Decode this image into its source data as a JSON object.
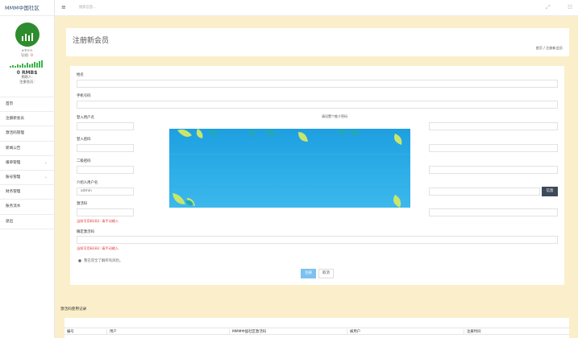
{
  "app": {
    "brand": "MMM中国社区"
  },
  "topbar": {
    "search_placeholder": "搜索信息..."
  },
  "profile": {
    "username": "admin",
    "level_prefix": "钻级:",
    "level_value": "0",
    "amount": "0 RMB$",
    "stat1": "捐助人:",
    "stat2": "注册会员:"
  },
  "nav": [
    {
      "label": "首页"
    },
    {
      "label": "注册新会员"
    },
    {
      "label": "激活码管理"
    },
    {
      "label": "新闻公告"
    },
    {
      "label": "报单管理"
    },
    {
      "label": "账号管理"
    },
    {
      "label": "财务管理"
    },
    {
      "label": "账务流水"
    },
    {
      "label": "退出"
    }
  ],
  "title": {
    "text": "注册新会员",
    "breadcrumb": "首页 / 注册新会员"
  },
  "form": {
    "name_label": "姓名",
    "phone_label": "手机号码",
    "login_user_label": "登入用户名",
    "login_pass_label": "登入密码",
    "second_pass_label": "二级密码",
    "referrer_label": "介绍人用户名",
    "referrer_value": "admin",
    "code_label": "激活码",
    "code_hint": "当前可用码(码): 请手动输入",
    "confirm_code_label": "确定激活码",
    "confirm_hint": "当前可用码(码): 请手动输入",
    "verify_button": "信息",
    "agree_text": "我已完全了解所有风险。",
    "register_button": "注册",
    "cancel_button": "取消",
    "partial_text": "请设置个推介密码"
  },
  "records": {
    "title": "激活码使用记录",
    "columns": [
      "编号",
      "用户",
      "MMM中国社区激活码",
      "被用户",
      "注册时间"
    ]
  }
}
